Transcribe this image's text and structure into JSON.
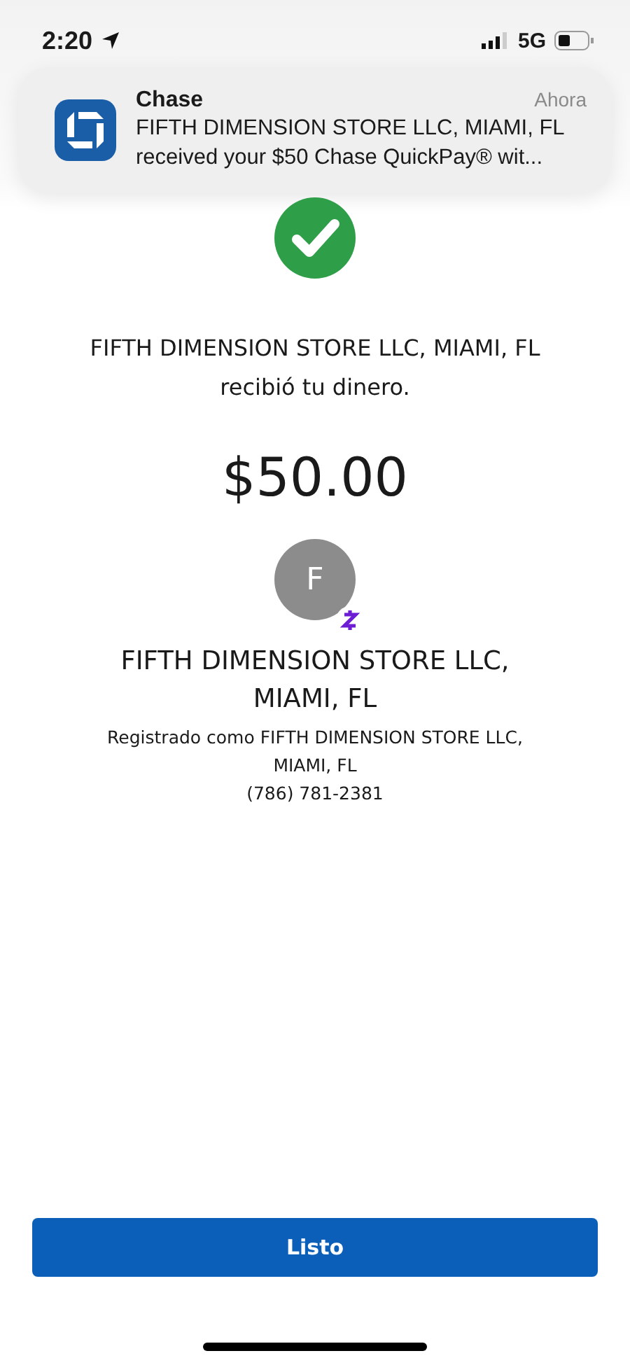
{
  "status_bar": {
    "time": "2:20",
    "network": "5G"
  },
  "notification": {
    "app": "Chase",
    "time": "Ahora",
    "line_1": "FIFTH DIMENSION STORE LLC, MIAMI, FL",
    "line_2": "received your $50 Chase QuickPay® wit..."
  },
  "confirmation": {
    "message_1": "FIFTH DIMENSION STORE LLC, MIAMI, FL",
    "message_2": "recibió tu dinero.",
    "amount": "$50.00"
  },
  "recipient": {
    "initial": "F",
    "name_1": "FIFTH DIMENSION STORE LLC,",
    "name_2": "MIAMI, FL",
    "registered_1": "Registrado como FIFTH DIMENSION STORE LLC,",
    "registered_2": "MIAMI, FL",
    "phone": "(786) 781-2381"
  },
  "buttons": [
    "Listo"
  ]
}
